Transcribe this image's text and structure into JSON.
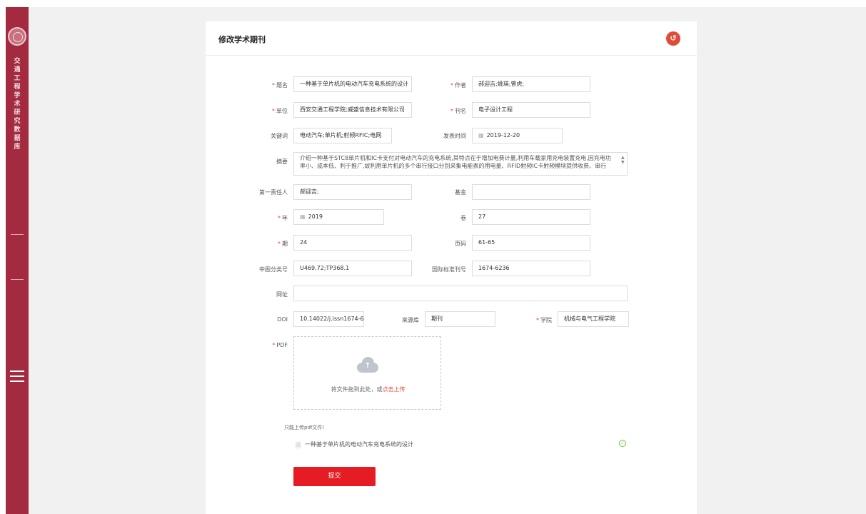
{
  "sidebar": {
    "title_vertical": "交通工程学术研究数据库",
    "logo_icon": "university-seal-icon",
    "menu_icon": "hamburger-menu-icon"
  },
  "page": {
    "title": "修改学术期刊",
    "back_icon": "return-icon"
  },
  "form": {
    "title_label": "题名",
    "title_value": "一种基于单片机的电动汽车充电系统的设计",
    "author_label": "作者",
    "author_value": "郝迎吉;姚瑛;曾虎;",
    "unit_label": "单位",
    "unit_value": "西安交通工程学院;威盛信息技术有限公司",
    "journal_label": "刊名",
    "journal_value": "电子设计工程",
    "keywords_label": "关键词",
    "keywords_value": "电动汽车;单片机;射频RFIC;电网",
    "pubdate_label": "发表时间",
    "pubdate_value": "2019-12-20",
    "abstract_label": "摘要",
    "abstract_value": "介绍一种基于STC8单片机和IC卡支付对电动汽车的充电系统,其特点在于增加电费计量,利用车载家用充电装置充电,因充电功率小、成本低、利于推广,故利用单片机的多个串行接口分别采集电能表的用电量、RFID射频IC卡射频模块提供收费、串行",
    "first_resp_label": "第一责任人",
    "first_resp_value": "郝迎吉;",
    "fund_label": "基金",
    "fund_value": "",
    "year_label": "年",
    "year_value": "2019",
    "volume_label": "卷",
    "volume_value": "27",
    "issue_label": "期",
    "issue_value": "24",
    "pages_label": "页码",
    "pages_value": "61-65",
    "clc_label": "中图分类号",
    "clc_value": "U469.72;TP368.1",
    "issn_label": "国际标准刊号",
    "issn_value": "1674-6236",
    "url_label": "网址",
    "url_value": "",
    "doi_label": "DOI",
    "doi_value": "10.14022/j.issn1674-6",
    "source_label": "来源库",
    "source_value": "期刊",
    "college_label": "学院",
    "college_value": "机械与电气工程学院",
    "pdf_label": "PDF",
    "upload_text": "将文件拖到此处，或",
    "upload_link": "点击上传",
    "upload_hint": "只能上传pdf文件!",
    "uploaded_file": "一种基于单片机的电动汽车充电系统的设计",
    "submit_label": "提交",
    "required_mark": "*"
  },
  "colors": {
    "sidebar": "#a32a3f",
    "accent": "#e51c23",
    "success": "#67c23a"
  }
}
